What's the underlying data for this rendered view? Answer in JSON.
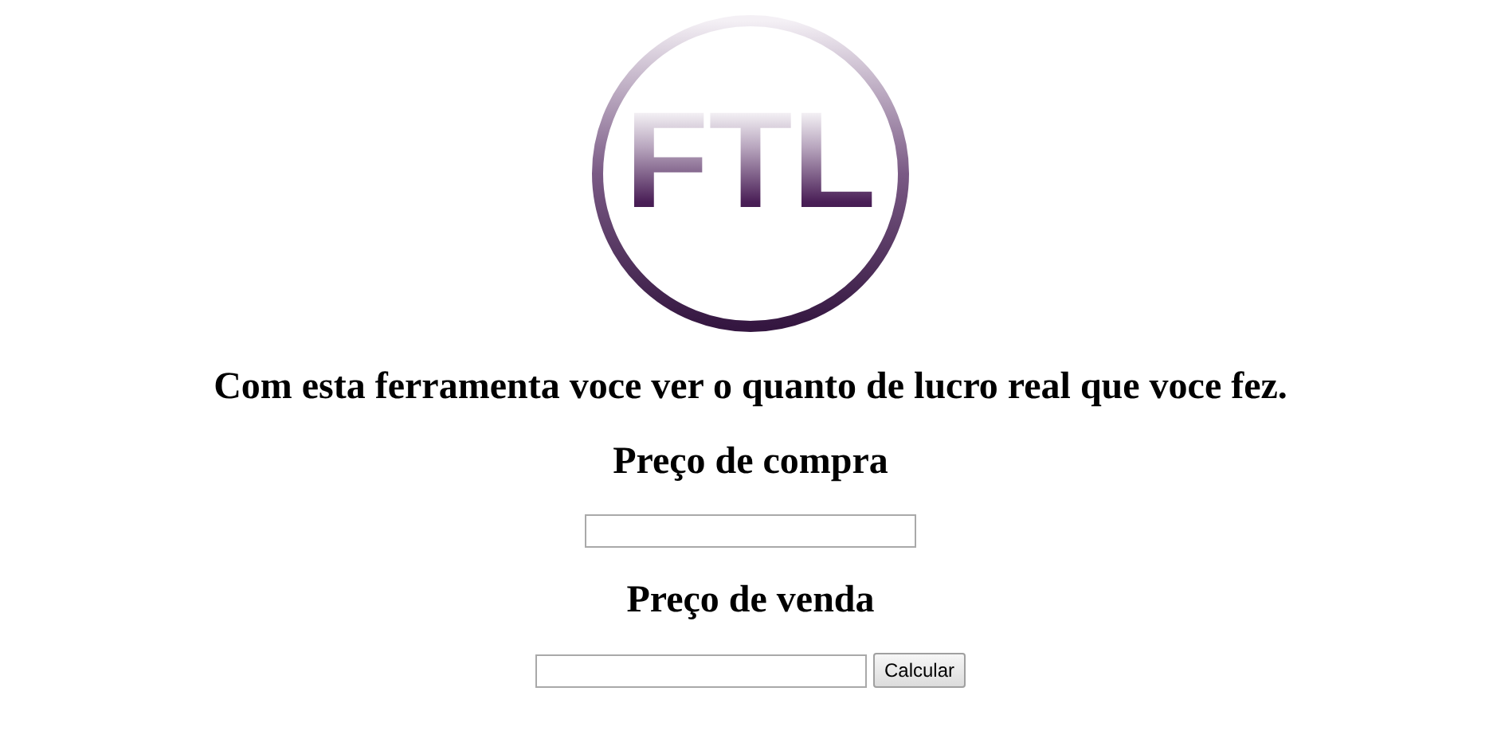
{
  "logo": {
    "text": "FTL"
  },
  "intro": "Com esta ferramenta voce ver o quanto de lucro real que voce fez.",
  "fields": [
    {
      "label": "Preço de compra"
    },
    {
      "label": "Preço de venda",
      "button": "Calcular"
    }
  ]
}
